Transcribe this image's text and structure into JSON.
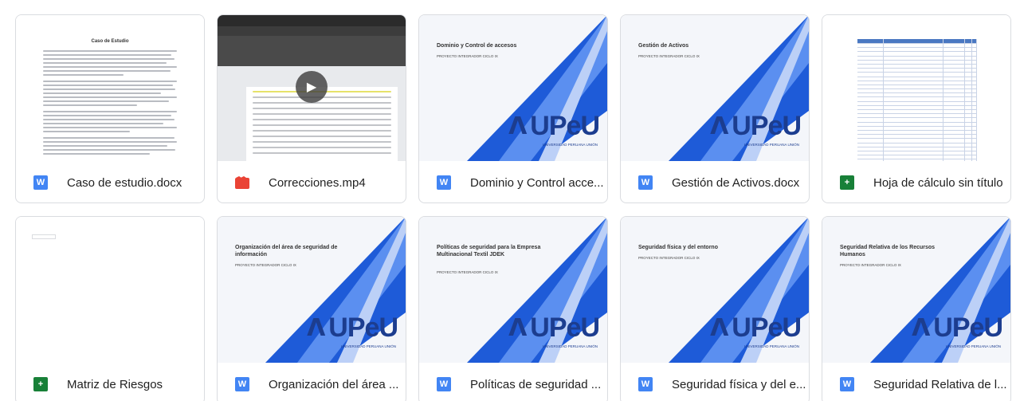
{
  "files": [
    {
      "name": "Caso de estudio.docx",
      "icon": "word-icon",
      "type_glyph": "W",
      "thumb": "doc",
      "doc_title": "Caso de Estudio"
    },
    {
      "name": "Correcciones.mp4",
      "icon": "video-icon",
      "type_glyph": "",
      "thumb": "video"
    },
    {
      "name": "Dominio y Control acce...",
      "icon": "word-icon",
      "type_glyph": "W",
      "thumb": "slide",
      "slide_title": "Dominio y Control de accesos",
      "slide_sub": "PROYECTO INTEGRADOR CICLO IX"
    },
    {
      "name": "Gestión de Activos.docx",
      "icon": "word-icon",
      "type_glyph": "W",
      "thumb": "slide",
      "slide_title": "Gestión de Activos",
      "slide_sub": "PROYECTO INTEGRADOR CICLO IX"
    },
    {
      "name": "Hoja de cálculo sin título",
      "icon": "sheets-icon",
      "type_glyph": "+",
      "thumb": "sheet"
    },
    {
      "name": "Matriz de Riesgos",
      "icon": "sheets-icon",
      "type_glyph": "+",
      "thumb": "blank"
    },
    {
      "name": "Organización del área ...",
      "icon": "word-icon",
      "type_glyph": "W",
      "thumb": "slide",
      "slide_title": "Organización del área de seguridad de información",
      "slide_sub": "PROYECTO INTEGRADOR CICLO IX"
    },
    {
      "name": "Políticas de seguridad ...",
      "icon": "word-icon",
      "type_glyph": "W",
      "thumb": "slide",
      "slide_title": "Políticas de seguridad para la Empresa Multinacional Textil JDEK",
      "slide_sub": "PROYECTO INTEGRADOR CICLO IX"
    },
    {
      "name": "Seguridad física y del e...",
      "icon": "word-icon",
      "type_glyph": "W",
      "thumb": "slide",
      "slide_title": "Seguridad física y del entorno",
      "slide_sub": "PROYECTO INTEGRADOR CICLO IX"
    },
    {
      "name": "Seguridad Relativa de l...",
      "icon": "word-icon",
      "type_glyph": "W",
      "thumb": "slide",
      "slide_title": "Seguridad Relativa de los Recursos Humanos",
      "slide_sub": "PROYECTO INTEGRADOR CICLO IX"
    }
  ],
  "logo_text": "UPeU",
  "logo_sub": "UNIVERSIDAD PERUANA UNIÓN",
  "colors": {
    "word": "#4285f4",
    "sheets": "#188038",
    "video": "#ea4335",
    "brand": "#1c3d8f"
  }
}
